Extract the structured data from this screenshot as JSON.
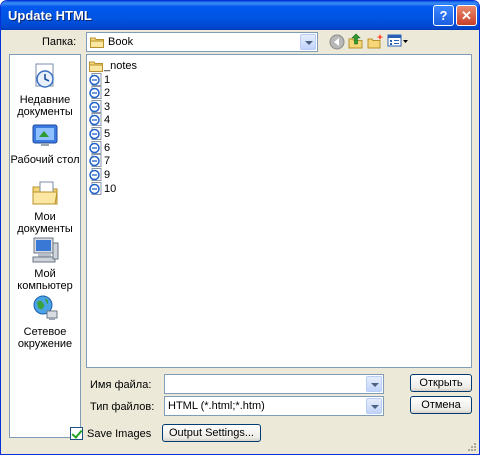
{
  "window": {
    "title": "Update HTML"
  },
  "titlebar_buttons": {
    "help": "?",
    "close": "✕"
  },
  "lookin": {
    "label": "Папка:",
    "value": "Book"
  },
  "places": [
    {
      "label": "Недавние документы",
      "icon": "recent-documents-icon"
    },
    {
      "label": "Рабочий стол",
      "icon": "desktop-icon"
    },
    {
      "label": "Мои документы",
      "icon": "my-documents-icon"
    },
    {
      "label": "Мой компьютер",
      "icon": "my-computer-icon"
    },
    {
      "label": "Сетевое окружение",
      "icon": "network-places-icon"
    }
  ],
  "files": [
    {
      "name": "_notes",
      "type": "folder"
    },
    {
      "name": "1",
      "type": "html"
    },
    {
      "name": "2",
      "type": "html"
    },
    {
      "name": "3",
      "type": "html"
    },
    {
      "name": "4",
      "type": "html"
    },
    {
      "name": "5",
      "type": "html"
    },
    {
      "name": "6",
      "type": "html"
    },
    {
      "name": "7",
      "type": "html"
    },
    {
      "name": "9",
      "type": "html"
    },
    {
      "name": "10",
      "type": "html"
    }
  ],
  "filename": {
    "label": "Имя файла:",
    "value": ""
  },
  "filetype": {
    "label": "Тип файлов:",
    "value": "HTML (*.html;*.htm)"
  },
  "buttons": {
    "open": "Открыть",
    "cancel": "Отмена",
    "output_settings": "Output Settings..."
  },
  "save_images": {
    "label": "Save Images",
    "checked": true
  },
  "colors": {
    "titlebar": "#0054e3",
    "dialog": "#ece9d8",
    "border": "#7f9db9"
  }
}
